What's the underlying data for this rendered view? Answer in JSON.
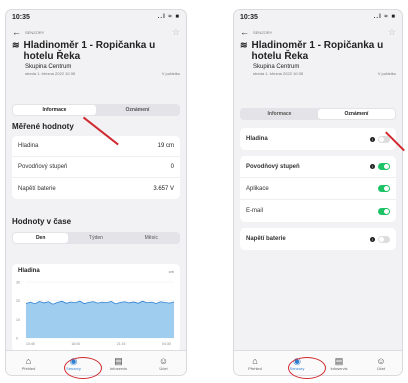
{
  "screen_a": {
    "status": {
      "time": "10:35",
      "signal": "..l ≈ ■"
    },
    "breadcrumb": "SENZORY",
    "title": "Hladinoměr 1 - Ropičanka u hotelu Řeka",
    "group": "Skupina Centrum",
    "date": "streda 1. března 2022 10:35",
    "status_label": "V pořádku",
    "tabs": [
      "Informace",
      "Oznámení"
    ],
    "measured_title": "Měřené hodnoty",
    "measured_rows": [
      {
        "label": "Hladina",
        "value": "19 cm"
      },
      {
        "label": "Povodňový stupeň",
        "value": "0"
      },
      {
        "label": "Napětí baterie",
        "value": "3.657 V"
      }
    ],
    "time_title": "Hodnoty v čase",
    "periods": [
      "Den",
      "Týden",
      "Měsíc"
    ],
    "chart_title": "Hladina",
    "chart_unit": "cm",
    "chart_data": {
      "type": "area",
      "title": "Hladina",
      "ylabel": "cm",
      "ylim": [
        0,
        30
      ],
      "yticks": [
        "30",
        "20",
        "10",
        "0"
      ],
      "xticks": [
        "10:45",
        "16:00",
        "21:15",
        "04:30"
      ],
      "x_labels_hint": "time of day",
      "series": [
        {
          "values": [
            18.5,
            19.2,
            18.3,
            19.6,
            18.8,
            19.4,
            18.1,
            19.0,
            19.7,
            18.6,
            19.3,
            18.9,
            19.8,
            18.4,
            19.1,
            19.5,
            18.7,
            19.2,
            18.9,
            19.6,
            18.3,
            19.0,
            19.4,
            18.8,
            19.3,
            18.6,
            19.7,
            18.9,
            19.2,
            18.5,
            19.4,
            19.0,
            18.7,
            19.3
          ]
        }
      ]
    },
    "nav": [
      {
        "label": "Přehled",
        "icon": "home-icon",
        "glyph": "⌂"
      },
      {
        "label": "Senzory",
        "icon": "sensor-icon",
        "glyph": "◉"
      },
      {
        "label": "Infoservis",
        "icon": "news-icon",
        "glyph": "▤"
      },
      {
        "label": "Účet",
        "icon": "account-icon",
        "glyph": "☺"
      }
    ]
  },
  "screen_b": {
    "status": {
      "time": "10:35",
      "signal": "..l ≈ ■"
    },
    "breadcrumb": "SENZORY",
    "title": "Hladinoměr 1 - Ropičanka u hotelu Řeka",
    "group": "Skupina Centrum",
    "date": "streda 1. března 2022 10:35",
    "status_label": "V pořádku",
    "tabs": [
      "Informace",
      "Oznámení"
    ],
    "notif_rows": [
      {
        "label": "Hladina",
        "info": true,
        "on": false
      },
      {
        "label": "Povodňový stupeň",
        "info": true,
        "on": true
      },
      {
        "label": "Aplikace",
        "info": false,
        "on": true
      },
      {
        "label": "E-mail",
        "info": false,
        "on": true
      },
      {
        "label": "Napětí baterie",
        "info": true,
        "on": false
      }
    ],
    "nav": [
      {
        "label": "Přehled",
        "icon": "home-icon",
        "glyph": "⌂"
      },
      {
        "label": "Senzory",
        "icon": "sensor-icon",
        "glyph": "◉"
      },
      {
        "label": "Infoservis",
        "icon": "news-icon",
        "glyph": "▤"
      },
      {
        "label": "Účet",
        "icon": "account-icon",
        "glyph": "☺"
      }
    ],
    "info_glyph": "!"
  },
  "colors": {
    "accent": "#2f7fd0",
    "toggle_on": "#1ec266",
    "annotation": "#d0282f",
    "chart_fill": "#9ecdf0"
  }
}
